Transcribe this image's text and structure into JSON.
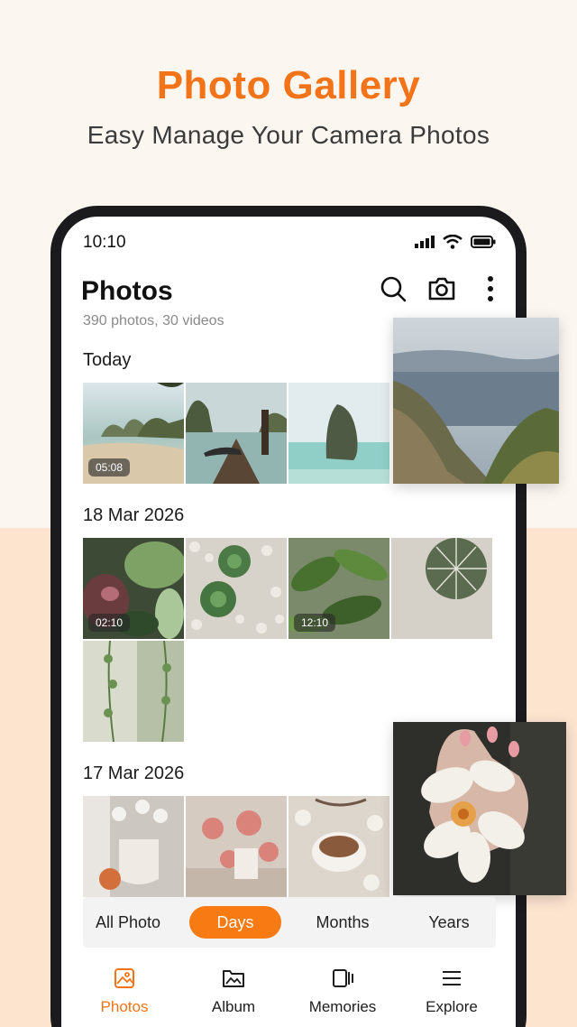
{
  "promo": {
    "title": "Photo Gallery",
    "subtitle": "Easy Manage Your Camera Photos"
  },
  "status_bar": {
    "time": "10:10",
    "icons": [
      "signal-icon",
      "wifi-icon",
      "battery-icon"
    ]
  },
  "header": {
    "title": "Photos",
    "count": "390 photos, 30 videos",
    "actions": [
      "search-icon",
      "camera-icon",
      "more-vertical-icon"
    ]
  },
  "sections": [
    {
      "label": "Today",
      "items": [
        {
          "subject": "beach-cliffs",
          "duration": "05:08"
        },
        {
          "subject": "longtail-boat",
          "duration": ""
        },
        {
          "subject": "sea-rock",
          "duration": ""
        }
      ]
    },
    {
      "label": "18 Mar 2026",
      "items": [
        {
          "subject": "leafy-plants",
          "duration": "02:10"
        },
        {
          "subject": "succulents-pebbles",
          "duration": ""
        },
        {
          "subject": "tropical-leaves",
          "duration": "12:10"
        },
        {
          "subject": "cactus-closeup",
          "duration": ""
        },
        {
          "subject": "hanging-vines",
          "duration": ""
        }
      ]
    },
    {
      "label": "17 Mar 2026",
      "items": [
        {
          "subject": "cotton-mug",
          "duration": ""
        },
        {
          "subject": "flowers-table",
          "duration": ""
        },
        {
          "subject": "coffee-cup",
          "duration": ""
        }
      ]
    }
  ],
  "floating_photos": [
    "mountain-lake",
    "white-flower-hand"
  ],
  "view_tabs": {
    "items": [
      "All Photo",
      "Days",
      "Months",
      "Years"
    ],
    "active": "Days"
  },
  "bottom_nav": {
    "items": [
      {
        "label": "Photos",
        "icon": "image-icon"
      },
      {
        "label": "Album",
        "icon": "folder-image-icon"
      },
      {
        "label": "Memories",
        "icon": "memories-icon"
      },
      {
        "label": "Explore",
        "icon": "menu-icon"
      }
    ],
    "active": "Photos"
  },
  "colors": {
    "accent": "#f37418",
    "active_tab": "#f77a12",
    "background_top": "#fcf6f1",
    "background_bottom": "#fde4cf",
    "phone_frame": "#1b1b1d"
  }
}
